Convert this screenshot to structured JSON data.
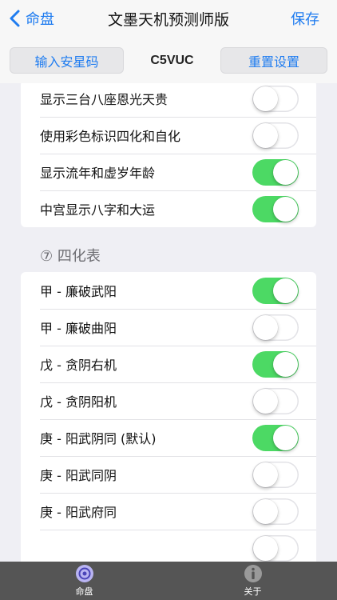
{
  "nav": {
    "back_label": "命盘",
    "title": "文墨天机预测师版",
    "save_label": "保存"
  },
  "toolbar": {
    "input_code_label": "输入安星码",
    "code": "C5VUC",
    "reset_label": "重置设置"
  },
  "settings_top": [
    {
      "label": "显示三台八座恩光天贵",
      "on": false
    },
    {
      "label": "使用彩色标识四化和自化",
      "on": false
    },
    {
      "label": "显示流年和虚岁年龄",
      "on": true
    },
    {
      "label": "中宫显示八字和大运",
      "on": true
    }
  ],
  "section_sihua": {
    "title": "⑦ 四化表"
  },
  "sihua_rows": [
    {
      "label": "甲 - 廉破武阳",
      "on": true
    },
    {
      "label": "甲 - 廉破曲阳",
      "on": false
    },
    {
      "label": "戊 - 贪阴右机",
      "on": true
    },
    {
      "label": "戊 - 贪阴阳机",
      "on": false
    },
    {
      "label": "庚 - 阳武阴同 (默认)",
      "on": true
    },
    {
      "label": "庚 - 阳武同阴",
      "on": false
    },
    {
      "label": "庚 - 阳武府同",
      "on": false
    },
    {
      "label": "",
      "on": false
    }
  ],
  "tabbar": {
    "home_label": "命盘",
    "about_label": "关于",
    "home_icon": "chart-disc-icon",
    "about_icon": "info-icon"
  },
  "colors": {
    "accent": "#1f7cf0",
    "toggle_on": "#4cd964",
    "tabbar_bg": "#555555"
  }
}
